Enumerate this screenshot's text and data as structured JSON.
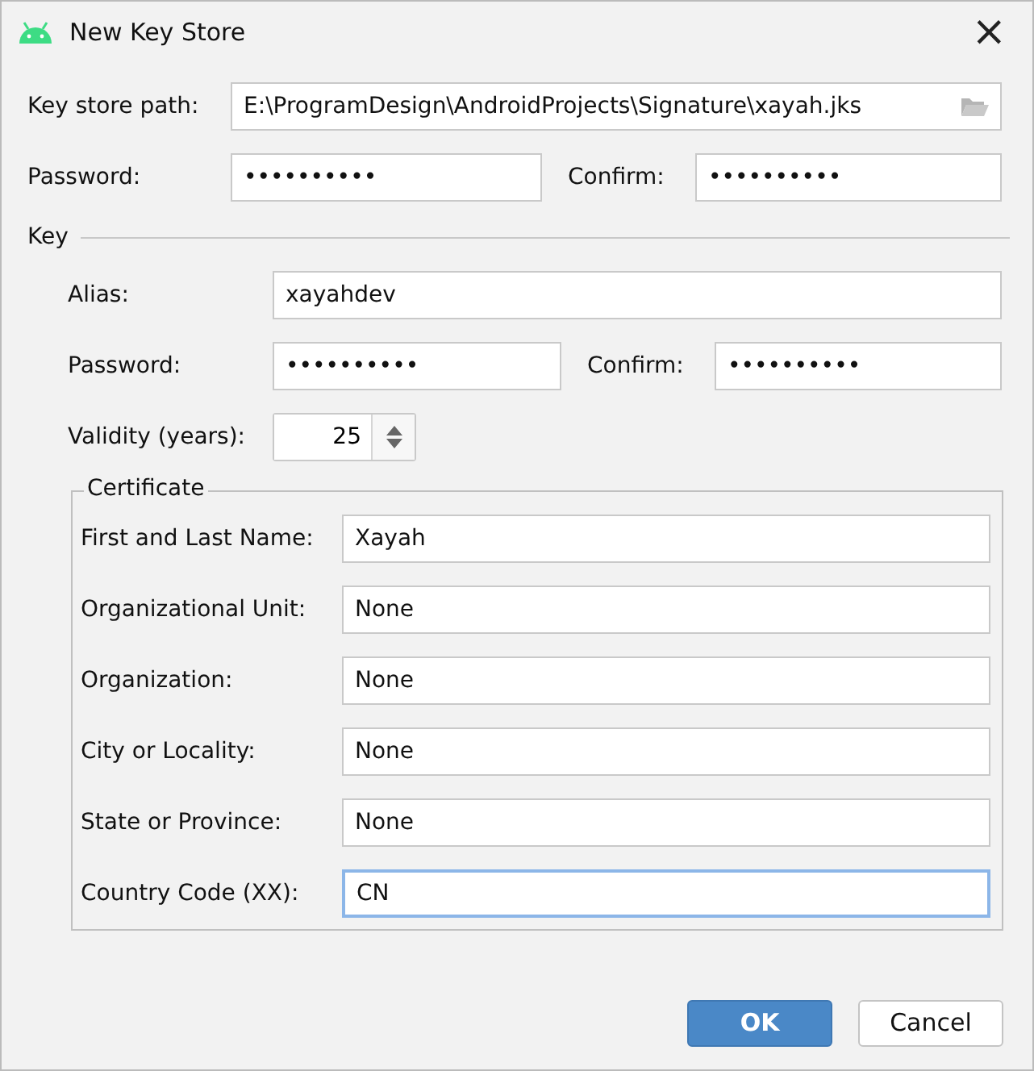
{
  "window": {
    "title": "New Key Store",
    "close": "×"
  },
  "key_store": {
    "path_label": "Key store path:",
    "path": "E:\\ProgramDesign\\AndroidProjects\\Signature\\xayah.jks",
    "password_label": "Password:",
    "password": "••••••••••",
    "confirm_label": "Confirm:",
    "confirm": "••••••••••"
  },
  "key": {
    "title": "Key",
    "alias_label": "Alias:",
    "alias": "xayahdev",
    "password_label": "Password:",
    "password": "••••••••••",
    "confirm_label": "Confirm:",
    "confirm": "••••••••••",
    "validity_label": "Validity (years):",
    "validity": "25"
  },
  "certificate": {
    "title": "Certificate",
    "fields": [
      {
        "label": "First and Last Name:",
        "value": "Xayah",
        "focused": false
      },
      {
        "label": "Organizational Unit:",
        "value": "None",
        "focused": false
      },
      {
        "label": "Organization:",
        "value": "None",
        "focused": false
      },
      {
        "label": "City or Locality:",
        "value": "None",
        "focused": false
      },
      {
        "label": "State or Province:",
        "value": "None",
        "focused": false
      },
      {
        "label": "Country Code (XX):",
        "value": "CN",
        "focused": true
      }
    ]
  },
  "buttons": [
    {
      "label": "OK",
      "default": true
    },
    {
      "label": "Cancel",
      "default": false
    }
  ]
}
